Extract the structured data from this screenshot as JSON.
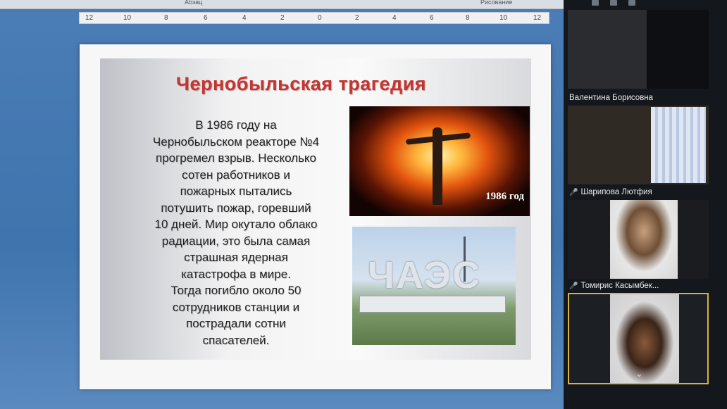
{
  "editor": {
    "ribbon_labels": [
      "Абзац",
      "Рисование"
    ],
    "ruler_ticks": [
      "12",
      "10",
      "8",
      "6",
      "4",
      "2",
      "0",
      "2",
      "4",
      "6",
      "8",
      "10",
      "12"
    ]
  },
  "slide": {
    "title": "Чернобыльская трагедия",
    "paragraph_lines": [
      "В 1986 году на",
      "Чернобыльском реакторе №4",
      "прогремел взрыв. Несколько",
      "сотен работников и",
      "пожарных пытались",
      "потушить пожар, горевший",
      "10 дней. Мир окутало облако",
      "радиации, это была самая",
      "страшная ядерная",
      "катастрофа в мире.",
      "Тогда погибло около 50",
      "сотрудников станции и",
      "пострадали сотни",
      "спасателей."
    ],
    "photo_explosion_caption": "1986 год",
    "photo_station_text": "ЧАЭС"
  },
  "participants": [
    {
      "name": "Валентина Борисовна",
      "muted": false
    },
    {
      "name": "Шарипова Лютфия",
      "muted": true
    },
    {
      "name": "Томирис Касымбек...",
      "muted": true
    }
  ],
  "icons": {
    "muted_mic": "mic-muted-icon",
    "scroll_more": "chevron-down-icon",
    "mic_glyph": "🎤",
    "chevron_glyph": "⌄"
  },
  "colors": {
    "title_red": "#c4352f",
    "active_border": "#d4b342",
    "sidebar_bg": "#14171c"
  }
}
